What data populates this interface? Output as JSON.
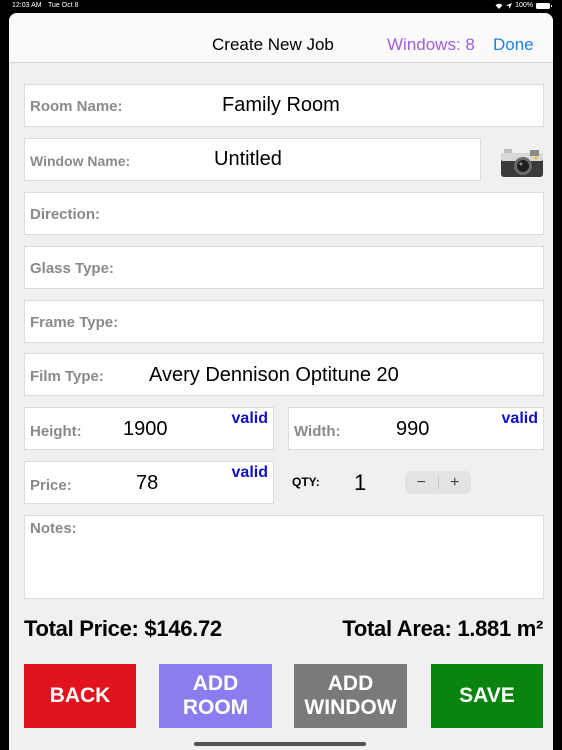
{
  "status_bar": {
    "time": "12:03 AM",
    "date": "Tue Oct 8",
    "battery": "100%"
  },
  "navbar": {
    "title": "Create New Job",
    "windows_count": "Windows: 8",
    "done_label": "Done"
  },
  "fields": {
    "room_name": {
      "label": "Room Name:",
      "value": "Family Room"
    },
    "window_name": {
      "label": "Window Name:",
      "value": "Untitled"
    },
    "direction": {
      "label": "Direction:",
      "value": ""
    },
    "glass_type": {
      "label": "Glass Type:",
      "value": ""
    },
    "frame_type": {
      "label": "Frame Type:",
      "value": ""
    },
    "film_type": {
      "label": "Film Type:",
      "value": "Avery Dennison Optitune 20"
    },
    "height": {
      "label": "Height:",
      "value": "1900",
      "status": "valid"
    },
    "width": {
      "label": "Width:",
      "value": "990",
      "status": "valid"
    },
    "price": {
      "label": "Price:",
      "value": "78",
      "status": "valid"
    },
    "notes": {
      "label": "Notes:",
      "value": ""
    }
  },
  "quantity": {
    "label": "QTY:",
    "value": "1",
    "decrement": "−",
    "increment": "+"
  },
  "totals": {
    "price": "Total Price: $146.72",
    "area": "Total Area: 1.881 m²"
  },
  "actions": {
    "back": {
      "label": "BACK",
      "color": "#e0131f"
    },
    "add_room": {
      "label": "ADD ROOM",
      "color": "#8b7df0"
    },
    "add_window": {
      "label": "ADD WINDOW",
      "color": "#7a7a7a"
    },
    "save": {
      "label": "SAVE",
      "color": "#0a840f"
    }
  },
  "icons": {
    "camera": "camera-icon",
    "wifi": "wifi-icon",
    "location": "location-icon",
    "battery": "battery-icon"
  }
}
